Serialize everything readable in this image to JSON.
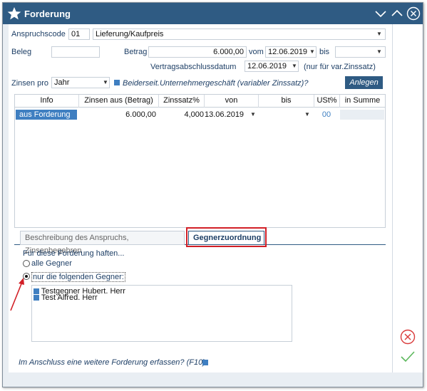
{
  "window": {
    "title": "Forderung"
  },
  "form": {
    "anspruchscode_label": "Anspruchscode",
    "anspruchscode_value": "01",
    "anspruch_value": "Lieferung/Kaufpreis",
    "beleg_label": "Beleg",
    "betrag_label": "Betrag",
    "betrag_value": "6.000,00",
    "vom_label": "vom",
    "vom_value": "12.06.2019",
    "bis_label": "bis",
    "vertrag_label": "Vertragsabschlussdatum",
    "vertrag_value": "12.06.2019",
    "vertrag_hint": "(nur für var.Zinssatz)",
    "zinsen_label": "Zinsen pro",
    "zinsen_value": "Jahr",
    "beiderseit_label": "Beiderseit.Unternehmergeschäft (variabler Zinssatz)?",
    "anlegen_button": "Anlegen"
  },
  "grid": {
    "headers": [
      "Info",
      "Zinsen aus (Betrag)",
      "Zinssatz%",
      "von",
      "bis",
      "USt%",
      "in Summe"
    ],
    "rows": [
      {
        "info": "aus Forderung",
        "betrag": "6.000,00",
        "zinssatz": "4,000",
        "von": "13.06.2019",
        "bis": "",
        "ust": "00",
        "summe": ""
      }
    ]
  },
  "tabs": [
    {
      "label": "Beschreibung des Anspruchs, Zinsenbegehren",
      "active": false
    },
    {
      "label": "Gegnerzuordnung",
      "active": true
    }
  ],
  "gegner": {
    "heading": "Für diese Forderung haften...",
    "option_all": "alle Gegner",
    "option_following": "nur die folgenden Gegner:",
    "selected": "following",
    "items": [
      "Testgegner Hubert. Herr",
      "Test Alfred. Herr"
    ]
  },
  "footer": {
    "question": "Im Anschluss eine weitere Forderung erfassen? (F10)"
  },
  "colors": {
    "titlebar": "#2f5b83",
    "accent": "#3f7fc1",
    "highlight": "#d21f26",
    "cancel": "#d93a3a",
    "ok": "#5cb85c"
  }
}
